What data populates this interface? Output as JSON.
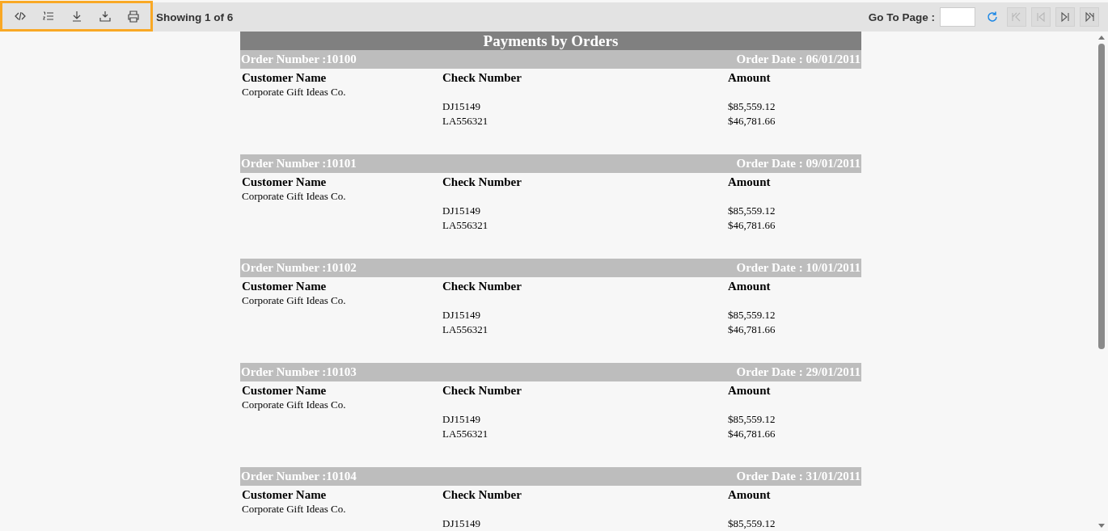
{
  "toolbar": {
    "tools": [
      {
        "kind": "code"
      },
      {
        "kind": "list"
      },
      {
        "kind": "download"
      },
      {
        "kind": "export"
      },
      {
        "kind": "print"
      }
    ],
    "page_status": "Showing 1 of 6",
    "goto_label": "Go To Page :",
    "nav": [
      {
        "kind": "refresh"
      },
      {
        "kind": "first",
        "disabled": true
      },
      {
        "kind": "prev",
        "disabled": true
      },
      {
        "kind": "next",
        "disabled": false
      },
      {
        "kind": "last",
        "disabled": false
      }
    ]
  },
  "report": {
    "title": "Payments by Orders",
    "orders": [
      {
        "number": "Order Number :10100",
        "date": "Order Date : 06/01/2011",
        "columns": [
          "Customer Name",
          "Check Number",
          "Amount"
        ],
        "customer": "Corporate Gift Ideas Co.",
        "payments": [
          {
            "check": "DJ15149",
            "amount": "$85,559.12"
          },
          {
            "check": "LA556321",
            "amount": "$46,781.66"
          }
        ]
      },
      {
        "number": "Order Number :10101",
        "date": "Order Date : 09/01/2011",
        "columns": [
          "Customer Name",
          "Check Number",
          "Amount"
        ],
        "customer": "Corporate Gift Ideas Co.",
        "payments": [
          {
            "check": "DJ15149",
            "amount": "$85,559.12"
          },
          {
            "check": "LA556321",
            "amount": "$46,781.66"
          }
        ]
      },
      {
        "number": "Order Number :10102",
        "date": "Order Date : 10/01/2011",
        "columns": [
          "Customer Name",
          "Check Number",
          "Amount"
        ],
        "customer": "Corporate Gift Ideas Co.",
        "payments": [
          {
            "check": "DJ15149",
            "amount": "$85,559.12"
          },
          {
            "check": "LA556321",
            "amount": "$46,781.66"
          }
        ]
      },
      {
        "number": "Order Number :10103",
        "date": "Order Date : 29/01/2011",
        "columns": [
          "Customer Name",
          "Check Number",
          "Amount"
        ],
        "customer": "Corporate Gift Ideas Co.",
        "payments": [
          {
            "check": "DJ15149",
            "amount": "$85,559.12"
          },
          {
            "check": "LA556321",
            "amount": "$46,781.66"
          }
        ]
      },
      {
        "number": "Order Number :10104",
        "date": "Order Date : 31/01/2011",
        "columns": [
          "Customer Name",
          "Check Number",
          "Amount"
        ],
        "customer": "Corporate Gift Ideas Co.",
        "payments": [
          {
            "check": "DJ15149",
            "amount": "$85,559.12"
          }
        ]
      }
    ]
  }
}
